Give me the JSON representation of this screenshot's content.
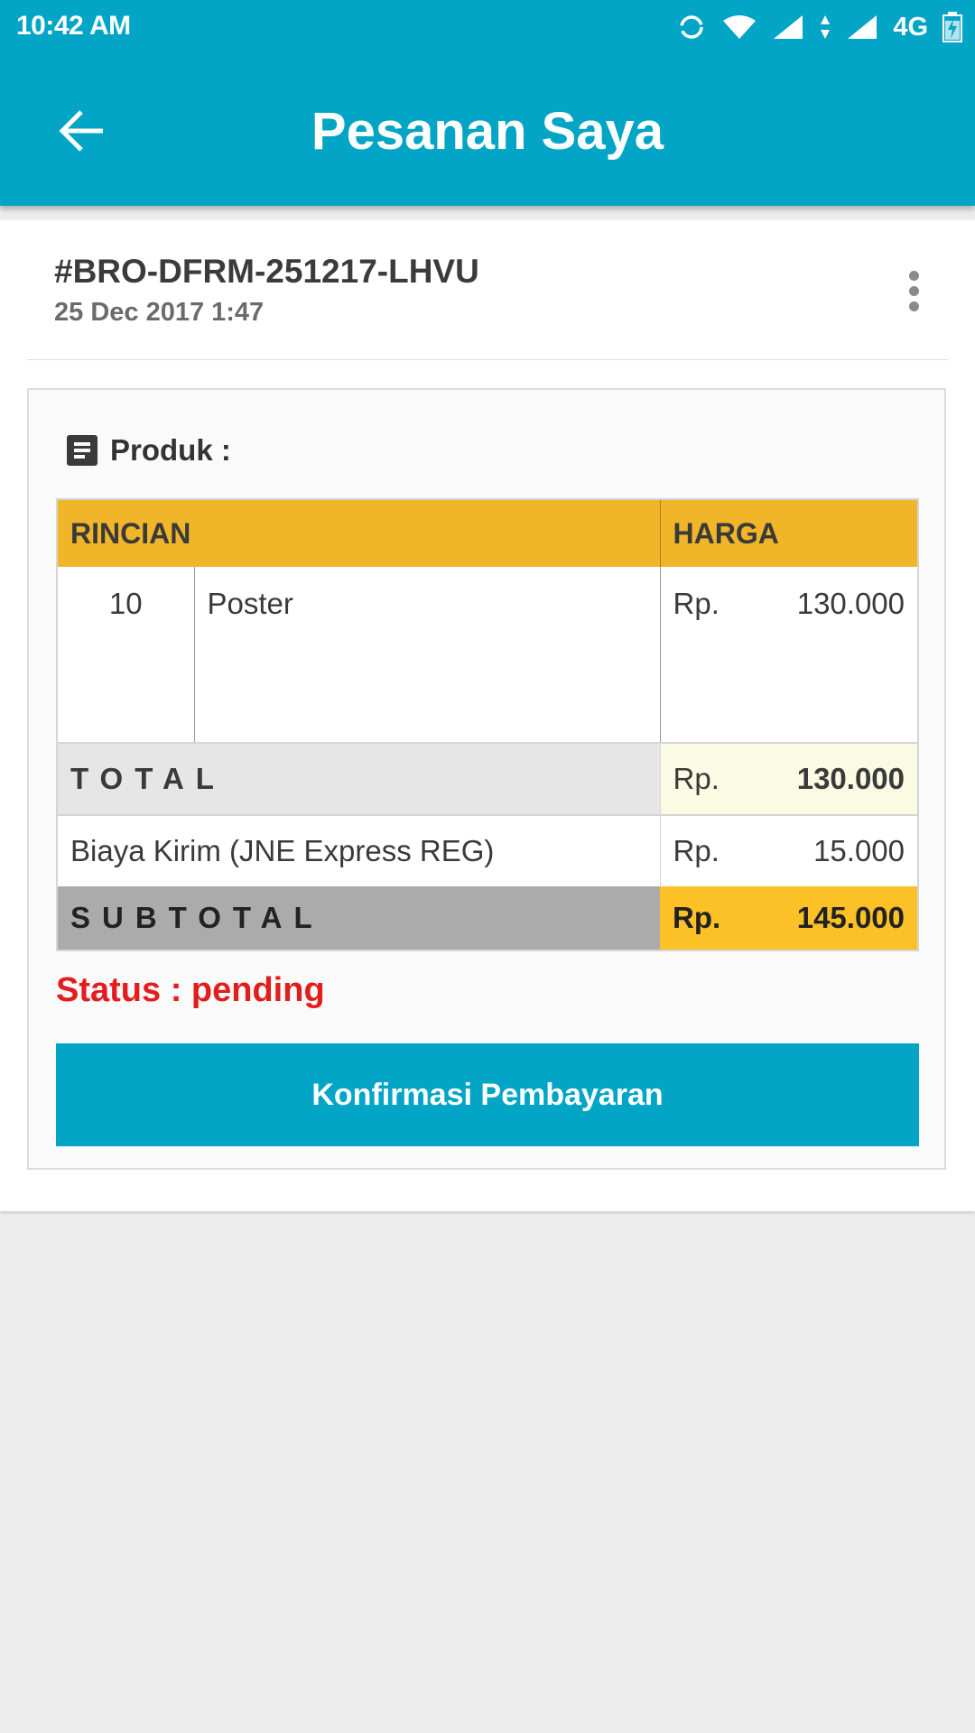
{
  "status_bar": {
    "time": "10:42 AM",
    "network": "4G",
    "icons": [
      "sync-icon",
      "wifi-icon",
      "signal-icon",
      "data-arrows-icon",
      "signal-icon",
      "battery-charging-icon"
    ]
  },
  "app_bar": {
    "title": "Pesanan Saya",
    "back_icon": "arrow-left-icon"
  },
  "order": {
    "id": "#BRO-DFRM-251217-LHVU",
    "date": "25 Dec 2017 1:47",
    "menu_icon": "more-vert-icon"
  },
  "products": {
    "heading": "Produk :",
    "icon": "document-icon",
    "table": {
      "col_detail": "RINCIAN",
      "col_price": "HARGA",
      "items": [
        {
          "qty": "10",
          "name": "Poster",
          "currency": "Rp.",
          "price": "130.000"
        }
      ],
      "total": {
        "label": "TOTAL",
        "currency": "Rp.",
        "value": "130.000"
      },
      "shipping": {
        "label": "Biaya Kirim (JNE Express REG)",
        "currency": "Rp.",
        "value": "15.000"
      },
      "subtotal": {
        "label": "SUBTOTAL",
        "currency": "Rp.",
        "value": "145.000"
      }
    }
  },
  "status_text": "Status : pending",
  "confirm_button": "Konfirmasi Pembayaran",
  "colors": {
    "primary": "#02a5c5",
    "table_header": "#f0b528",
    "subtotal_highlight": "#fcc126",
    "status_red": "#e31c1c"
  }
}
